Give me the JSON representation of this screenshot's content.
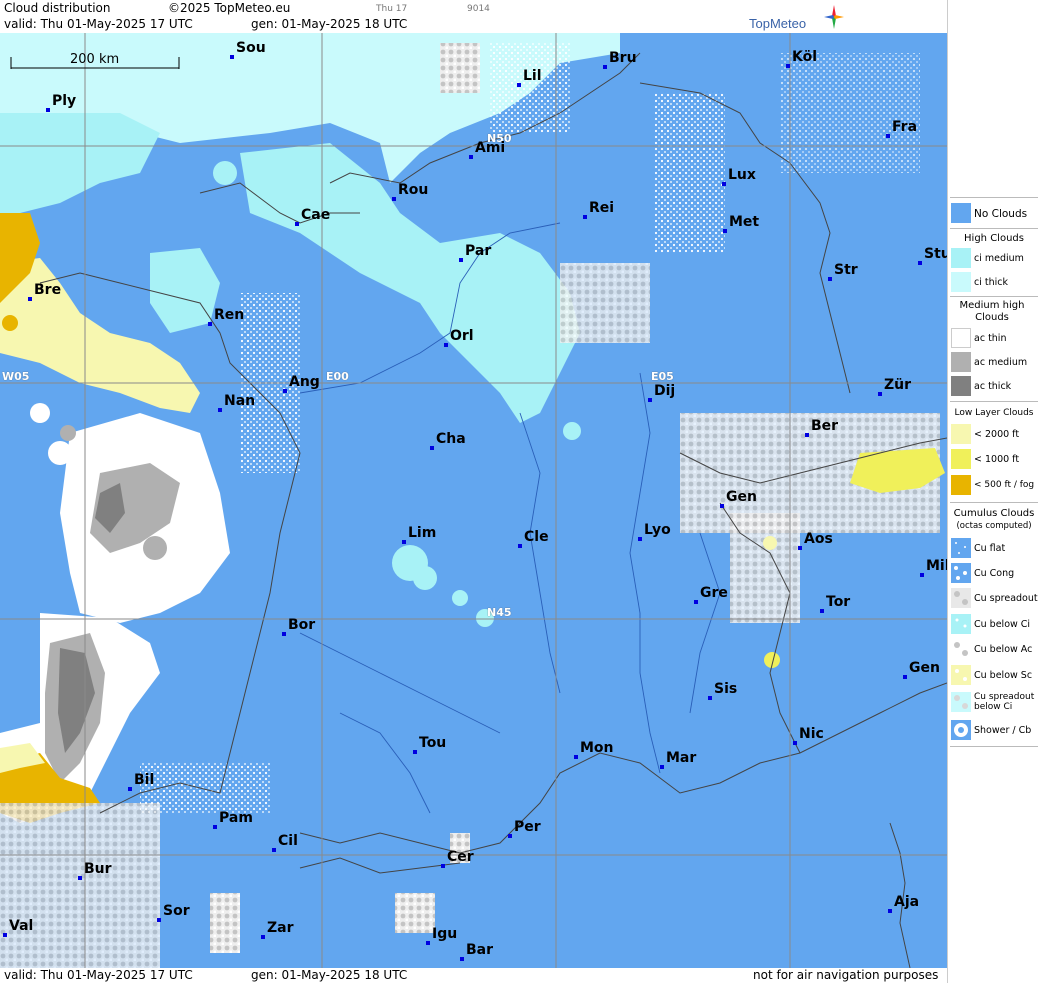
{
  "header": {
    "title": "Cloud distribution",
    "copyright": "©2025 TopMeteo.eu",
    "run_small_1": "Thu 17",
    "run_small_2": "9014",
    "valid_line": "valid:  Thu  01-May-2025  17 UTC",
    "gen_line": "gen: 01-May-2025 18 UTC",
    "logo_text": "TopMeteo"
  },
  "map": {
    "scale_label": "200 km",
    "grid_labels": [
      "N50",
      "N45",
      "W05",
      "E00",
      "E05"
    ],
    "cities": [
      {
        "name": "Sou"
      },
      {
        "name": "Ply"
      },
      {
        "name": "Lil"
      },
      {
        "name": "Bru"
      },
      {
        "name": "Köl"
      },
      {
        "name": "Ami"
      },
      {
        "name": "Fra"
      },
      {
        "name": "Rou"
      },
      {
        "name": "Lux"
      },
      {
        "name": "Cae"
      },
      {
        "name": "Rei"
      },
      {
        "name": "Met"
      },
      {
        "name": "Bre"
      },
      {
        "name": "Par"
      },
      {
        "name": "Stu"
      },
      {
        "name": "Str"
      },
      {
        "name": "Ren"
      },
      {
        "name": "Orl"
      },
      {
        "name": "Ang"
      },
      {
        "name": "Dij"
      },
      {
        "name": "Zür"
      },
      {
        "name": "Nan"
      },
      {
        "name": "Cha"
      },
      {
        "name": "Ber"
      },
      {
        "name": "Gen"
      },
      {
        "name": "Lim"
      },
      {
        "name": "Cle"
      },
      {
        "name": "Lyo"
      },
      {
        "name": "Aos"
      },
      {
        "name": "Mil"
      },
      {
        "name": "Gre"
      },
      {
        "name": "Tor"
      },
      {
        "name": "Bor"
      },
      {
        "name": "Gen"
      },
      {
        "name": "Sis"
      },
      {
        "name": "Nic"
      },
      {
        "name": "Tou"
      },
      {
        "name": "Mon"
      },
      {
        "name": "Mar"
      },
      {
        "name": "Bil"
      },
      {
        "name": "Pam"
      },
      {
        "name": "Per"
      },
      {
        "name": "Cil"
      },
      {
        "name": "Cer"
      },
      {
        "name": "Bur"
      },
      {
        "name": "Sor"
      },
      {
        "name": "Aja"
      },
      {
        "name": "Val"
      },
      {
        "name": "Zar"
      },
      {
        "name": "Igu"
      },
      {
        "name": "Bar"
      }
    ]
  },
  "footer": {
    "valid_line": "valid:  Thu  01-May-2025  17 UTC",
    "gen_line": "gen: 01-May-2025 18 UTC",
    "disclaimer": "not for air navigation purposes"
  },
  "legend": {
    "no_clouds": "No Clouds",
    "high_head": "High Clouds",
    "ci_medium": "ci medium",
    "ci_thick": "ci thick",
    "medium_head": "Medium high Clouds",
    "ac_thin": "ac thin",
    "ac_medium": "ac medium",
    "ac_thick": "ac thick",
    "low_head": "Low Layer Clouds",
    "low_2000": "< 2000 ft",
    "low_1000": "< 1000 ft",
    "low_500": "< 500 ft / fog",
    "cu_head": "Cumulus Clouds",
    "cu_sub": "(octas computed)",
    "cu_flat": "Cu flat",
    "cu_cong": "Cu Cong",
    "cu_spread": "Cu spreadout",
    "cu_below_ci": "Cu below Ci",
    "cu_below_ac": "Cu below Ac",
    "cu_below_sc": "Cu below Sc",
    "cu_spread_ci": "Cu spreadout below Ci",
    "shower": "Shower / Cb"
  },
  "colors": {
    "no_clouds": "#62a6ef",
    "ci_medium": "#a8f2f6",
    "ci_thick": "#c9fafc",
    "ac_thin": "#ffffff",
    "ac_medium": "#b0b0b0",
    "ac_thick": "#808080",
    "low_2000": "#f7f7b0",
    "low_1000": "#f0f05a",
    "low_500": "#e8b400"
  }
}
